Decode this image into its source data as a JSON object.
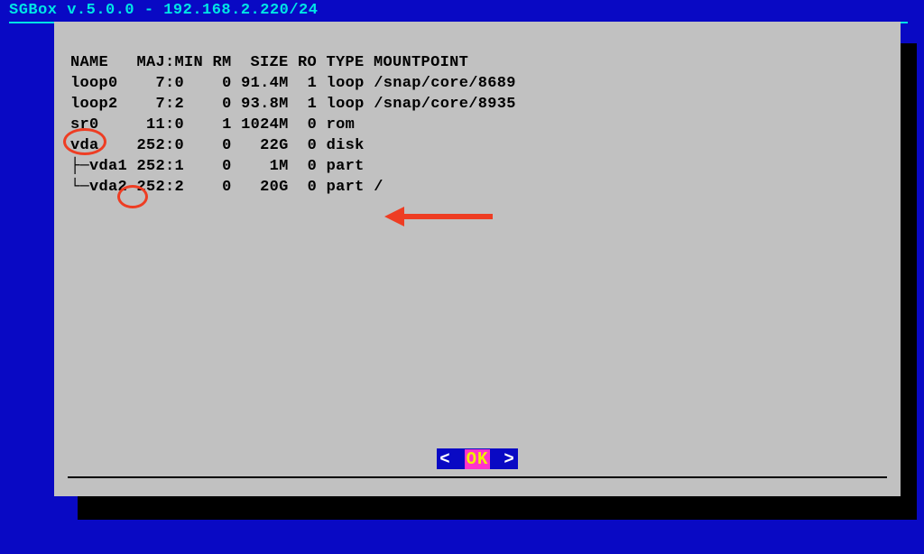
{
  "titlebar": {
    "text": "SGBox v.5.0.0 - 192.168.2.220/24"
  },
  "lsblk": {
    "headers": {
      "text": "NAME   MAJ:MIN RM  SIZE RO TYPE MOUNTPOINT"
    },
    "rows": [
      {
        "name": "loop0",
        "majmin": "7:0",
        "rm": "0",
        "size": "91.4M",
        "ro": "1",
        "type": "loop",
        "mount": "/snap/core/8689"
      },
      {
        "name": "loop2",
        "majmin": "7:2",
        "rm": "0",
        "size": "93.8M",
        "ro": "1",
        "type": "loop",
        "mount": "/snap/core/8935"
      },
      {
        "name": "sr0",
        "majmin": "11:0",
        "rm": "1",
        "size": "1024M",
        "ro": "0",
        "type": "rom",
        "mount": ""
      },
      {
        "name": "vda",
        "majmin": "252:0",
        "rm": "0",
        "size": "22G",
        "ro": "0",
        "type": "disk",
        "mount": ""
      },
      {
        "name": "├─vda1",
        "majmin": "252:1",
        "rm": "0",
        "size": "1M",
        "ro": "0",
        "type": "part",
        "mount": ""
      },
      {
        "name": "└─vda2",
        "majmin": "252:2",
        "rm": "0",
        "size": "20G",
        "ro": "0",
        "type": "part",
        "mount": "/"
      }
    ]
  },
  "button": {
    "ok": "OK",
    "left": "<",
    "right": ">"
  },
  "annotations": {
    "circle_vda": true,
    "circle_vda2_suffix": true,
    "arrow_vda2": true
  },
  "colors": {
    "background": "#0909c4",
    "dialog_bg": "#c1c1c1",
    "title_fg": "#00e5e5",
    "annotation": "#ee3d23",
    "ok_bg": "#0909c4",
    "ok_highlight": "#ff33cc",
    "ok_text": "#f0f000"
  }
}
